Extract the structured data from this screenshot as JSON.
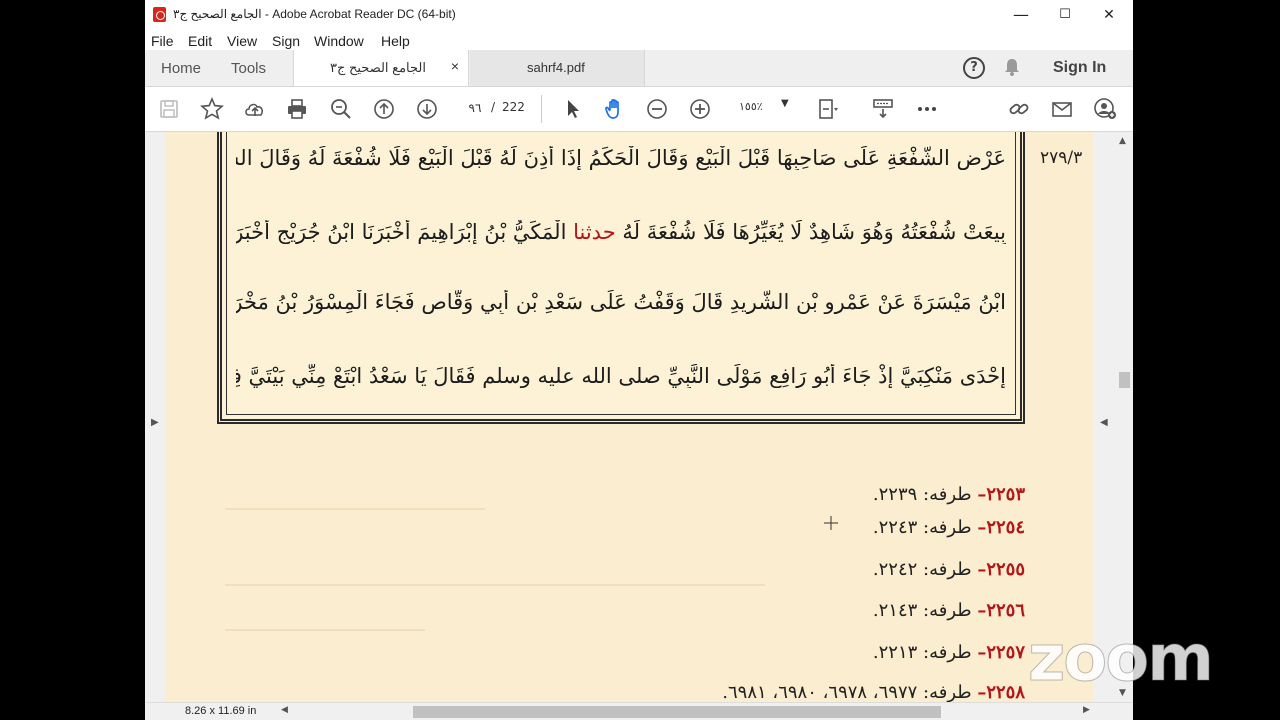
{
  "window": {
    "title": "الجامع الصحيح ج٣ - Adobe Acrobat Reader DC (64-bit)",
    "controls": {
      "minimize": "—",
      "maximize": "☐",
      "close": "✕"
    }
  },
  "menu": [
    "File",
    "Edit",
    "View",
    "Sign",
    "Window",
    "Help"
  ],
  "tabs": {
    "home": "Home",
    "tools": "Tools",
    "documents": [
      {
        "label": "الجامع الصحيح ج٣",
        "close": "×",
        "active": true
      },
      {
        "label": "sahrf4.pdf",
        "active": false
      }
    ],
    "help_icon": "?",
    "sign_in": "Sign In"
  },
  "toolbar": {
    "current_page": "٩٦",
    "separator": "/",
    "total_pages": "222",
    "zoom": "١٥٥٪"
  },
  "document": {
    "margin_reference": "٢٧٩/٣",
    "lines": [
      {
        "text": "عَرْضِ الشُّفْعَةِ عَلَى صَاحِبِهَا قَبْلَ الْبَيْعِ   وَقَالَ الْحَكَمُ إِذَا أَذِنَ لَهُ قَبْلَ الْبَيْعِ فَلَا شُفْعَةَ لَهُ وَقَالَ الشَّعْبِيُّ مَنْ"
      },
      {
        "before": "بِيعَتْ شُفْعَتُهُ وَهُوَ شَاهِدٌ لَا يُغَيِّرُهَا فَلَا شُفْعَةَ لَهُ",
        "red": "حدثنا",
        "after": "الْمَكِّيُّ بْنُ إِبْرَاهِيمَ أَخْبَرَنَا ابْنُ جُرَيْجٍ أَخْبَرَنِي إِبْرَاهِيمُ"
      },
      {
        "text": "ابْنُ مَيْسَرَةَ عَنْ عَمْرِو بْنِ الشَّرِيدِ قَالَ وَقَفْتُ عَلَى سَعْدِ بْنِ أَبِي وَقَّاصٍ فَجَاءَ الْمِسْوَرُ بْنُ مَخْرَمَةَ فَوَضَعَ يَدَهُ عَلَى"
      },
      {
        "text": "إِحْدَى مَنْكِبَيَّ إِذْ جَاءَ أَبُو رَافِعٍ مَوْلَى النَّبِيِّ صلى الله عليه وسلم فَقَالَ يَا سَعْدُ ابْتَعْ مِنِّي بَيْتَيَّ فِي دَارِكَ فَقَالَ سَعْدٌ"
      }
    ],
    "notes": [
      {
        "number": "٢٢٥٣–",
        "label": "طرفه:",
        "refs": "٢٢٣٩."
      },
      {
        "number": "٢٢٥٤–",
        "label": "طرفه:",
        "refs": "٢٢٤٣."
      },
      {
        "number": "٢٢٥٥–",
        "label": "طرفه:",
        "refs": "٢٢٤٢."
      },
      {
        "number": "٢٢٥٦–",
        "label": "طرفه:",
        "refs": "٢١٤٣."
      },
      {
        "number": "٢٢٥٧–",
        "label": "طرفه:",
        "refs": "٢٢١٣."
      },
      {
        "number": "٢٢٥٨–",
        "label": "طرفه:",
        "refs": "٦٩٧٧، ٦٩٧٨، ٦٩٨٠، ٦٩٨١."
      }
    ]
  },
  "status": {
    "page_size": "8.26 x 11.69 in"
  },
  "overlay": {
    "logo": "zoom"
  },
  "colors": {
    "accent_red": "#b3161a",
    "page_bg": "#fbedcf",
    "acrobat_red": "#d9261c"
  }
}
